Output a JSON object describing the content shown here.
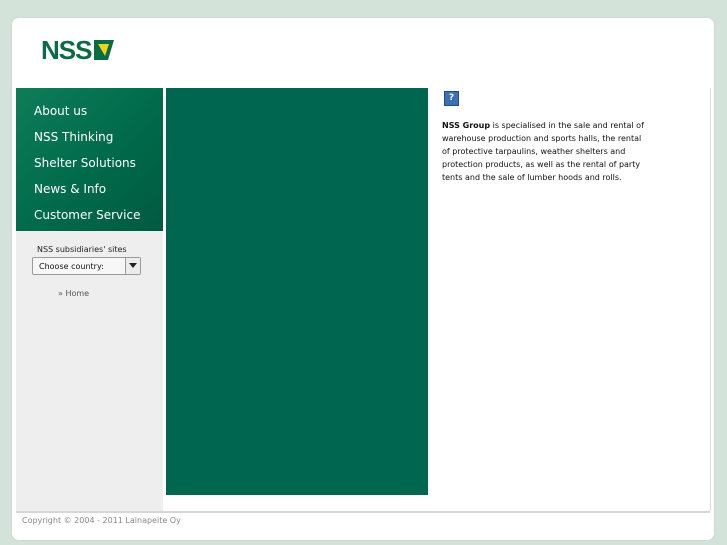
{
  "logo": {
    "text": "NSS"
  },
  "nav": {
    "items": [
      {
        "label": "About us"
      },
      {
        "label": "NSS Thinking"
      },
      {
        "label": "Shelter Solutions"
      },
      {
        "label": "News & Info"
      },
      {
        "label": "Customer Service"
      }
    ]
  },
  "subsidiaries": {
    "label": "NSS subsidiaries' sites",
    "select_value": "Choose country:"
  },
  "breadcrumb": {
    "home": "» Home"
  },
  "content": {
    "help_icon": "?",
    "intro_bold": "NSS Group",
    "intro_text": " is specialised in the sale and rental of warehouse production and sports halls, the rental of protective tarpaulins, weather shelters and protection products, as well as the rental of party tents and the sale of lumber hoods and rolls."
  },
  "footer": {
    "copyright": "Copyright © 2004 - 2011 Lainapeite Oy"
  },
  "colors": {
    "brand_green": "#0a6b45",
    "panel_green": "#006650",
    "logo_yellow": "#e8d51c",
    "background": "#d3e3d9"
  }
}
